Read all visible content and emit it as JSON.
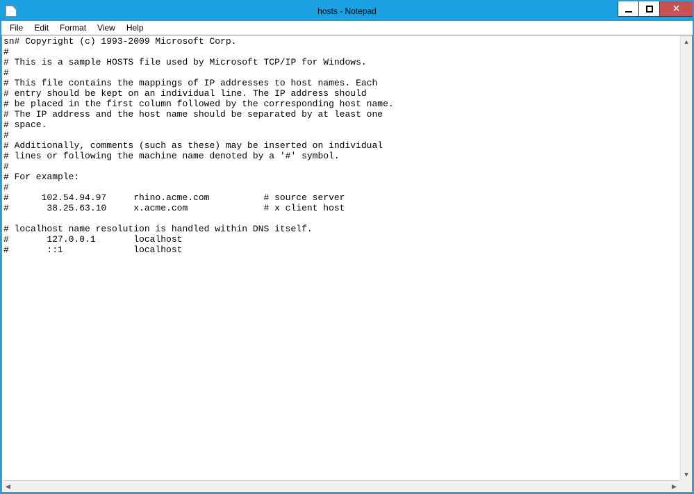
{
  "window": {
    "title": "hosts - Notepad"
  },
  "menu": {
    "file": "File",
    "edit": "Edit",
    "format": "Format",
    "view": "View",
    "help": "Help"
  },
  "content": "sn# Copyright (c) 1993-2009 Microsoft Corp.\n#\n# This is a sample HOSTS file used by Microsoft TCP/IP for Windows.\n#\n# This file contains the mappings of IP addresses to host names. Each\n# entry should be kept on an individual line. The IP address should\n# be placed in the first column followed by the corresponding host name.\n# The IP address and the host name should be separated by at least one\n# space.\n#\n# Additionally, comments (such as these) may be inserted on individual\n# lines or following the machine name denoted by a '#' symbol.\n#\n# For example:\n#\n#      102.54.94.97     rhino.acme.com          # source server\n#       38.25.63.10     x.acme.com              # x client host\n\n# localhost name resolution is handled within DNS itself.\n#\t127.0.0.1       localhost\n#\t::1             localhost"
}
